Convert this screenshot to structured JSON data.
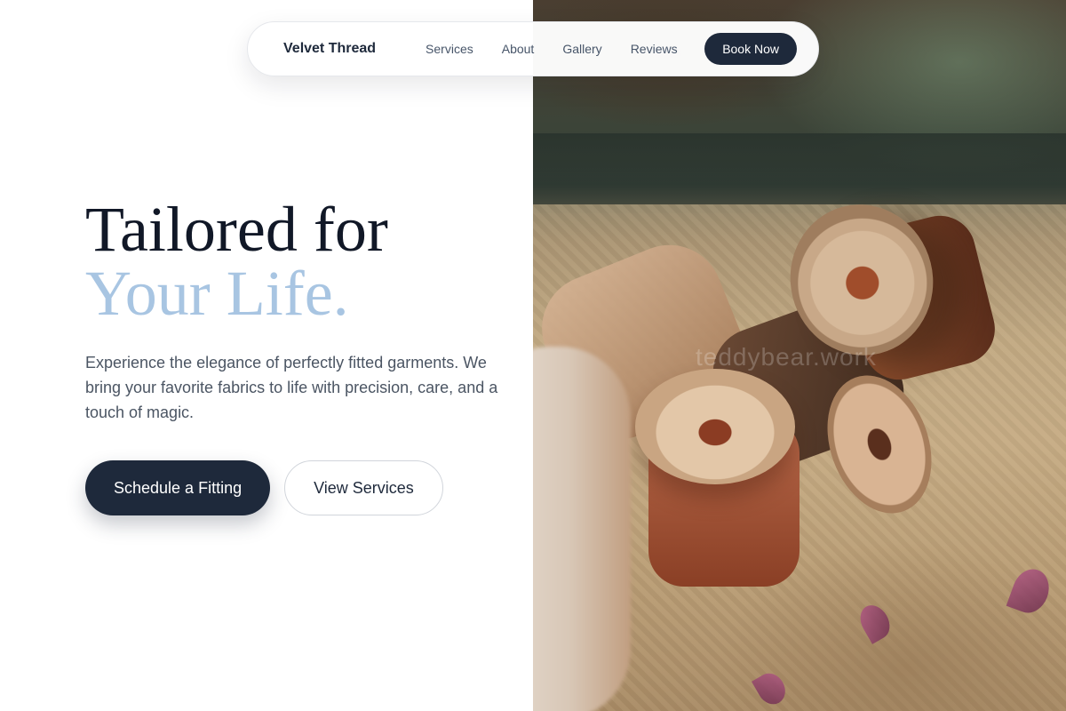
{
  "nav": {
    "brand": "Velvet Thread",
    "links": [
      "Services",
      "About",
      "Gallery",
      "Reviews"
    ],
    "cta": "Book Now"
  },
  "hero": {
    "headline_line1": "Tailored for",
    "headline_line2": "Your Life.",
    "lead": "Experience the elegance of perfectly fitted garments. We bring your favorite fabrics to life with precision, care, and a touch of magic.",
    "primary_cta": "Schedule a Fitting",
    "secondary_cta": "View Services"
  },
  "image": {
    "watermark": "teddybear.work"
  },
  "colors": {
    "primary": "#1e293b",
    "accent": "#a8c5e2",
    "text": "#111827",
    "muted": "#4b5563"
  }
}
